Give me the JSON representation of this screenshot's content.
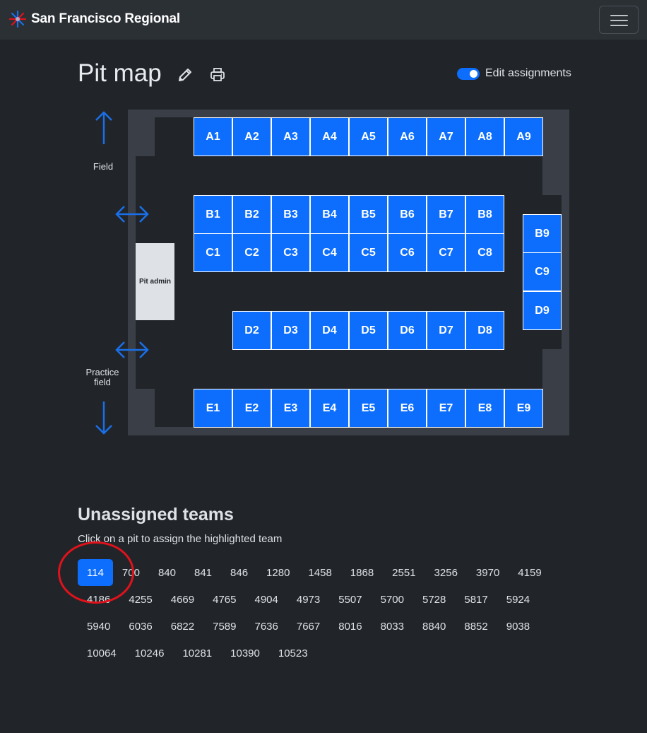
{
  "navbar": {
    "title": "San Francisco Regional",
    "menu_icon": "hamburger-icon"
  },
  "header": {
    "title": "Pit map",
    "edit_icon": "pencil-icon",
    "print_icon": "printer-icon",
    "toggle_label": "Edit assignments",
    "toggle_on": true
  },
  "pitmap": {
    "field_label": "Field",
    "practice_label_line1": "Practice",
    "practice_label_line2": "field",
    "pit_admin_label": "Pit admin",
    "pits": [
      "A1",
      "A2",
      "A3",
      "A4",
      "A5",
      "A6",
      "A7",
      "A8",
      "A9",
      "B1",
      "B2",
      "B3",
      "B4",
      "B5",
      "B6",
      "B7",
      "B8",
      "B9",
      "C1",
      "C2",
      "C3",
      "C4",
      "C5",
      "C6",
      "C7",
      "C8",
      "C9",
      "D2",
      "D3",
      "D4",
      "D5",
      "D6",
      "D7",
      "D8",
      "D9",
      "E1",
      "E2",
      "E3",
      "E4",
      "E5",
      "E6",
      "E7",
      "E8",
      "E9"
    ]
  },
  "unassigned": {
    "title": "Unassigned teams",
    "instruction": "Click on a pit to assign the highlighted team",
    "selected_team": "114",
    "teams": [
      "114",
      "700",
      "840",
      "841",
      "846",
      "1280",
      "1458",
      "1868",
      "2551",
      "3256",
      "3970",
      "4159",
      "4186",
      "4255",
      "4669",
      "4765",
      "4904",
      "4973",
      "5507",
      "5700",
      "5728",
      "5817",
      "5924",
      "5940",
      "6036",
      "6822",
      "7589",
      "7636",
      "7667",
      "8016",
      "8033",
      "8840",
      "8852",
      "9038",
      "10064",
      "10246",
      "10281",
      "10390",
      "10523"
    ]
  },
  "colors": {
    "accent": "#0d6efd",
    "annotation": "#e0121b",
    "background": "#212529",
    "navbar": "#2b3035"
  }
}
